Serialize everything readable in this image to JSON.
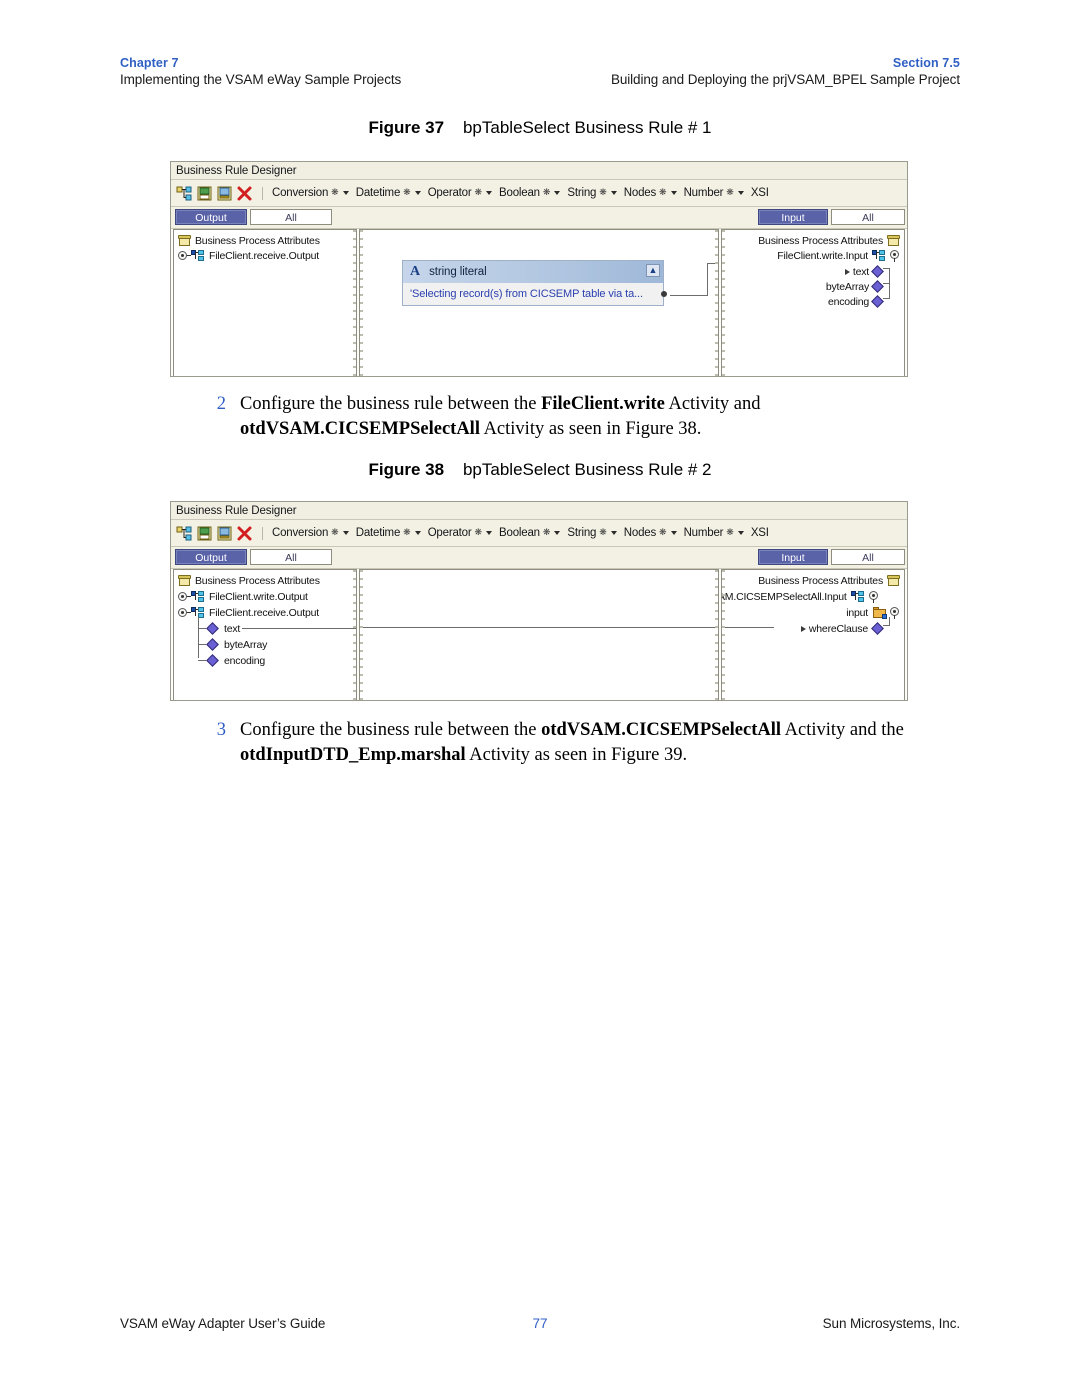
{
  "header": {
    "chapter_label": "Chapter 7",
    "chapter_subtitle": "Implementing the VSAM eWay Sample Projects",
    "section_label": "Section 7.5",
    "section_subtitle": "Building and Deploying the prjVSAM_BPEL Sample Project"
  },
  "figure37": {
    "caption_label": "Figure 37",
    "caption_title": "bpTableSelect Business Rule # 1",
    "window_title": "Business Rule Designer",
    "toolbar": {
      "icons": [
        "map-icon",
        "save-icon",
        "save-as-icon",
        "delete-icon"
      ],
      "menus": [
        "Conversion",
        "Datetime",
        "Operator",
        "Boolean",
        "String",
        "Nodes",
        "Number",
        "XSI"
      ]
    },
    "tabs": {
      "output_label": "Output",
      "output_all_label": "All",
      "input_label": "Input",
      "input_all_label": "All"
    },
    "left_tree": [
      {
        "label": "Business Process Attributes",
        "icon": "business-process-attributes-icon",
        "indent": 0
      },
      {
        "label": "FileClient.receive.Output",
        "icon": "node-icon",
        "indent": 1
      }
    ],
    "canvas_node": {
      "type_glyph": "A",
      "title": "string literal",
      "value": "'Selecting record(s) from CICSEMP table via ta...",
      "collapse_label": "▲"
    },
    "right_tree": [
      {
        "label": "Business Process Attributes",
        "icon": "business-process-attributes-icon"
      },
      {
        "label": "FileClient.write.Input",
        "icon": "node-icon"
      },
      {
        "label": "text",
        "icon": "diamond-icon"
      },
      {
        "label": "byteArray",
        "icon": "diamond-icon"
      },
      {
        "label": "encoding",
        "icon": "diamond-icon"
      }
    ]
  },
  "step2": {
    "number": "2",
    "part1": "Configure the business rule between the ",
    "bold1": "FileClient.write",
    "part2": " Activity and ",
    "bold2": "otdVSAM.CICSEMPSelectAll",
    "part3": " Activity as seen in Figure 38."
  },
  "figure38": {
    "caption_label": "Figure 38",
    "caption_title": "bpTableSelect Business Rule # 2",
    "window_title": "Business Rule Designer",
    "toolbar": {
      "icons": [
        "map-icon",
        "save-icon",
        "save-as-icon",
        "delete-icon"
      ],
      "menus": [
        "Conversion",
        "Datetime",
        "Operator",
        "Boolean",
        "String",
        "Nodes",
        "Number",
        "XSI"
      ]
    },
    "tabs": {
      "output_label": "Output",
      "output_all_label": "All",
      "input_label": "Input",
      "input_all_label": "All"
    },
    "left_tree": [
      {
        "label": "Business Process Attributes",
        "icon": "business-process-attributes-icon"
      },
      {
        "label": "FileClient.write.Output",
        "icon": "node-icon"
      },
      {
        "label": "FileClient.receive.Output",
        "icon": "node-icon"
      },
      {
        "label": "text",
        "icon": "diamond-icon"
      },
      {
        "label": "byteArray",
        "icon": "diamond-icon"
      },
      {
        "label": "encoding",
        "icon": "diamond-icon"
      }
    ],
    "right_tree": [
      {
        "label": "Business Process Attributes",
        "icon": "business-process-attributes-icon"
      },
      {
        "label": "AM.CICSEMPSelectAll.Input",
        "icon": "node-icon"
      },
      {
        "label": "input",
        "icon": "folder-icon"
      },
      {
        "label": "whereClause",
        "icon": "diamond-icon"
      }
    ]
  },
  "step3": {
    "number": "3",
    "part1": "Configure the business rule between the ",
    "bold1": "otdVSAM.CICSEMPSelectAll",
    "part2": " Activity",
    "part3": "and the ",
    "bold2": "otdInputDTD_Emp.marshal",
    "part4": " Activity as seen in Figure 39."
  },
  "footer": {
    "left": "VSAM eWay Adapter User’s Guide",
    "page_number": "77",
    "right": "Sun Microsystems, Inc."
  },
  "colors": {
    "accent_blue": "#2f5fc4",
    "tab_selected": "#5a63a8",
    "frame_bg": "#f3f1e4"
  }
}
